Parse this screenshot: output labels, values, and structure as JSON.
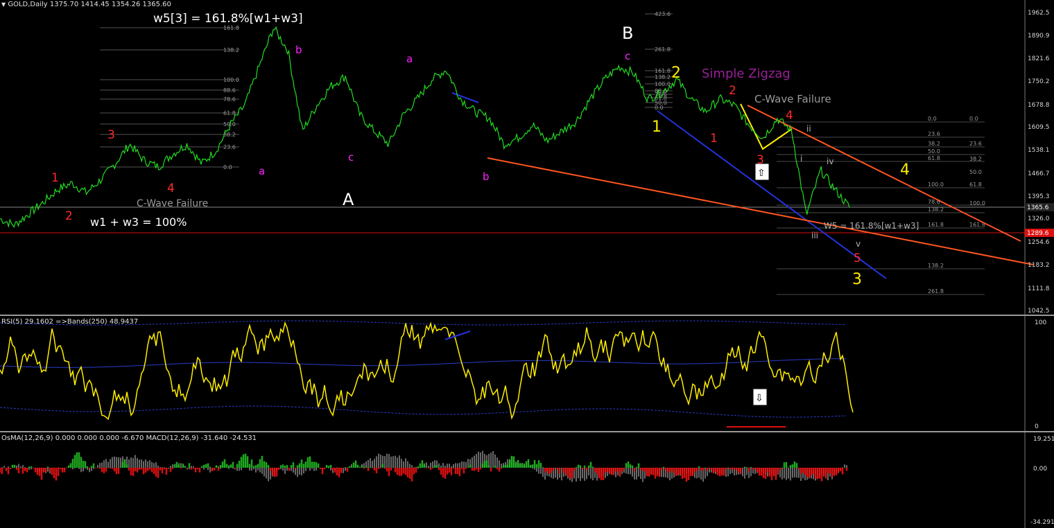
{
  "header": {
    "symbol": "GOLD,Daily",
    "ohlc": "1375.70 1414.45 1354.26 1365.60"
  },
  "price_panel": {
    "price_axis": [
      "1962.5",
      "1890.9",
      "1821.6",
      "1750.2",
      "1678.8",
      "1609.5",
      "1538.1",
      "1466.7",
      "1395.3",
      "1326.0",
      "1254.6",
      "1183.2",
      "1111.8",
      "1042.5"
    ],
    "current_price": "1365.6",
    "red_line_price": "1289.6",
    "labels": [
      {
        "t": "w5[3] = 161.8%[w1+w3]",
        "c": "#ffffff",
        "s": 17
      },
      {
        "t": "w1 + w3 = 100%",
        "c": "#ffffff",
        "s": 16
      },
      {
        "t": "C-Wave Failure",
        "c": "#9a9a9a",
        "s": 14
      },
      {
        "t": "C-Wave Failure",
        "c": "#9a9a9a",
        "s": 15
      },
      {
        "t": "Simple Zigzag",
        "c": "#9a1f9a",
        "s": 18
      },
      {
        "t": "W5 = 161.8%[w1+w3]",
        "c": "#b0b0b0",
        "s": 12
      },
      {
        "t": "A",
        "c": "#ffffff",
        "s": 24
      },
      {
        "t": "B",
        "c": "#ffffff",
        "s": 24
      },
      {
        "t": "1",
        "c": "#ff2a2a",
        "s": 17
      },
      {
        "t": "2",
        "c": "#ff2a2a",
        "s": 17
      },
      {
        "t": "3",
        "c": "#ff2a2a",
        "s": 17
      },
      {
        "t": "4",
        "c": "#ff2a2a",
        "s": 17
      },
      {
        "t": "1",
        "c": "#ff2a2a",
        "s": 17
      },
      {
        "t": "2",
        "c": "#ff2a2a",
        "s": 17
      },
      {
        "t": "3",
        "c": "#ff2a2a",
        "s": 17
      },
      {
        "t": "4",
        "c": "#ff2a2a",
        "s": 17
      },
      {
        "t": "5",
        "c": "#ff2a2a",
        "s": 17
      },
      {
        "t": "a",
        "c": "#ff22ff",
        "s": 15
      },
      {
        "t": "b",
        "c": "#ff22ff",
        "s": 15
      },
      {
        "t": "c",
        "c": "#ff22ff",
        "s": 15
      },
      {
        "t": "a",
        "c": "#ff22ff",
        "s": 15
      },
      {
        "t": "b",
        "c": "#ff22ff",
        "s": 15
      },
      {
        "t": "c",
        "c": "#ff22ff",
        "s": 15
      },
      {
        "t": "1",
        "c": "#ffee00",
        "s": 22
      },
      {
        "t": "2",
        "c": "#ffee00",
        "s": 22
      },
      {
        "t": "3",
        "c": "#ffee00",
        "s": 22
      },
      {
        "t": "4",
        "c": "#ffee00",
        "s": 22
      },
      {
        "t": "i",
        "c": "#b0b0b0",
        "s": 12
      },
      {
        "t": "ii",
        "c": "#b0b0b0",
        "s": 12
      },
      {
        "t": "iii",
        "c": "#b0b0b0",
        "s": 12
      },
      {
        "t": "iv",
        "c": "#b0b0b0",
        "s": 12
      },
      {
        "t": "v",
        "c": "#b0b0b0",
        "s": 12
      }
    ],
    "fib_left": [
      "161.8",
      "138.2",
      "100.0",
      "88.6",
      "78.6",
      "61.8",
      "50.0",
      "38.2",
      "23.6",
      "0.0"
    ],
    "fib_mid": [
      "423.6",
      "261.8",
      "161.8",
      "138.2",
      "100.0",
      "88.6",
      "78.6",
      "61.8",
      "50.0",
      "0.0"
    ],
    "fib_right_a": [
      "0.0",
      "23.6",
      "38.2",
      "50.0",
      "61.8",
      "100.0",
      "78.6",
      "138.2",
      "161.8",
      "138.2",
      "261.8"
    ],
    "fib_right_b": [
      "0.0",
      "23.6",
      "38.2",
      "50.0",
      "61.8",
      "100.0",
      "161.8"
    ]
  },
  "rsi_panel": {
    "title": "RSI(5) 29.1602  =>Bands(250) 48.9437",
    "axis": [
      "100",
      "0"
    ]
  },
  "macd_panel": {
    "title": "OsMA(12,26,9) 0.000 0.000 0.000 -6.670  MACD(12,26,9) -31.640 -24.531",
    "axis": [
      "19.251",
      "0.00",
      "-34.291"
    ]
  },
  "colors": {
    "price_line": "#22dd22",
    "rsi_line": "#ffee00",
    "blue_line": "#2233dd",
    "orange_line": "#ff5522",
    "red_level": "#dd1111",
    "hist_green": "#22bb22",
    "hist_red": "#ee1111",
    "macd_gray": "#cfcfcf"
  },
  "chart_data": {
    "type": "line",
    "title": "GOLD,Daily",
    "series": [
      {
        "name": "GOLD",
        "values": [
          1330,
          1310,
          1345,
          1380,
          1420,
          1440,
          1410,
          1450,
          1500,
          1560,
          1510,
          1490,
          1530,
          1560,
          1500,
          1540,
          1620,
          1680,
          1800,
          1920,
          1850,
          1600,
          1680,
          1740,
          1770,
          1650,
          1600,
          1560,
          1650,
          1700,
          1760,
          1790,
          1700,
          1660,
          1640,
          1560,
          1580,
          1620,
          1570,
          1600,
          1630,
          1700,
          1760,
          1800,
          1780,
          1700,
          1720,
          1760,
          1700,
          1660,
          1700,
          1680,
          1620,
          1580,
          1640,
          1600,
          1340,
          1480,
          1420,
          1365
        ]
      }
    ],
    "ylim": [
      1042.5,
      1962.5
    ]
  }
}
